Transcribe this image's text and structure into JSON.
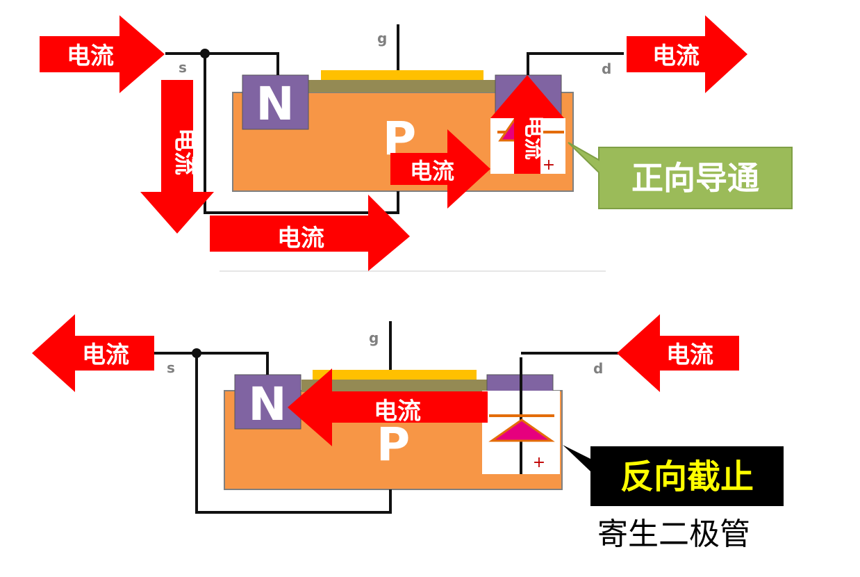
{
  "labels": {
    "current": "电流",
    "source": "s",
    "gate": "g",
    "drain": "d",
    "n_region": "N",
    "p_region": "P",
    "plus": "+",
    "forward_conduction": "正向导通",
    "reverse_blocking": "反向截止",
    "caption": "寄生二极管"
  },
  "colors": {
    "current_arrow": "#ff0000",
    "n_region": "#8064a2",
    "p_substrate": "#f79646",
    "gate": "#ffc000",
    "oxide": "#948a54",
    "forward_callout": "#9bbb59",
    "reverse_callout": "#000000",
    "reverse_text": "#ffff00",
    "diode_fill": "#e6007e",
    "diode_line": "#e36c09"
  }
}
